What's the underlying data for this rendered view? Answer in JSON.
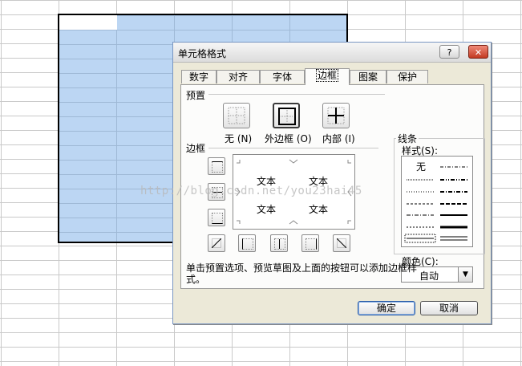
{
  "dialog": {
    "title": "单元格格式",
    "help_label": "?",
    "close_label": "✕",
    "tabs": [
      {
        "label": "数字"
      },
      {
        "label": "对齐"
      },
      {
        "label": "字体"
      },
      {
        "label": "边框"
      },
      {
        "label": "图案"
      },
      {
        "label": "保护"
      }
    ],
    "presets_label": "预置",
    "presets": [
      {
        "label": "无 (N)"
      },
      {
        "label": "外边框 (O)"
      },
      {
        "label": "内部 (I)"
      }
    ],
    "border_label": "边框",
    "preview_text": [
      "文本",
      "文本",
      "文本",
      "文本"
    ],
    "line_group_label": "线条",
    "style_label": "样式(S):",
    "style_none": "无",
    "color_label": "颜色(C):",
    "color_value": "自动",
    "help_text_line1": "单击预置选项、预览草图及上面的按钮可以添加边框样",
    "help_text_line2": "式。",
    "ok_label": "确定",
    "cancel_label": "取消"
  },
  "watermark": "http://blog.csdn.net/you23hai45"
}
